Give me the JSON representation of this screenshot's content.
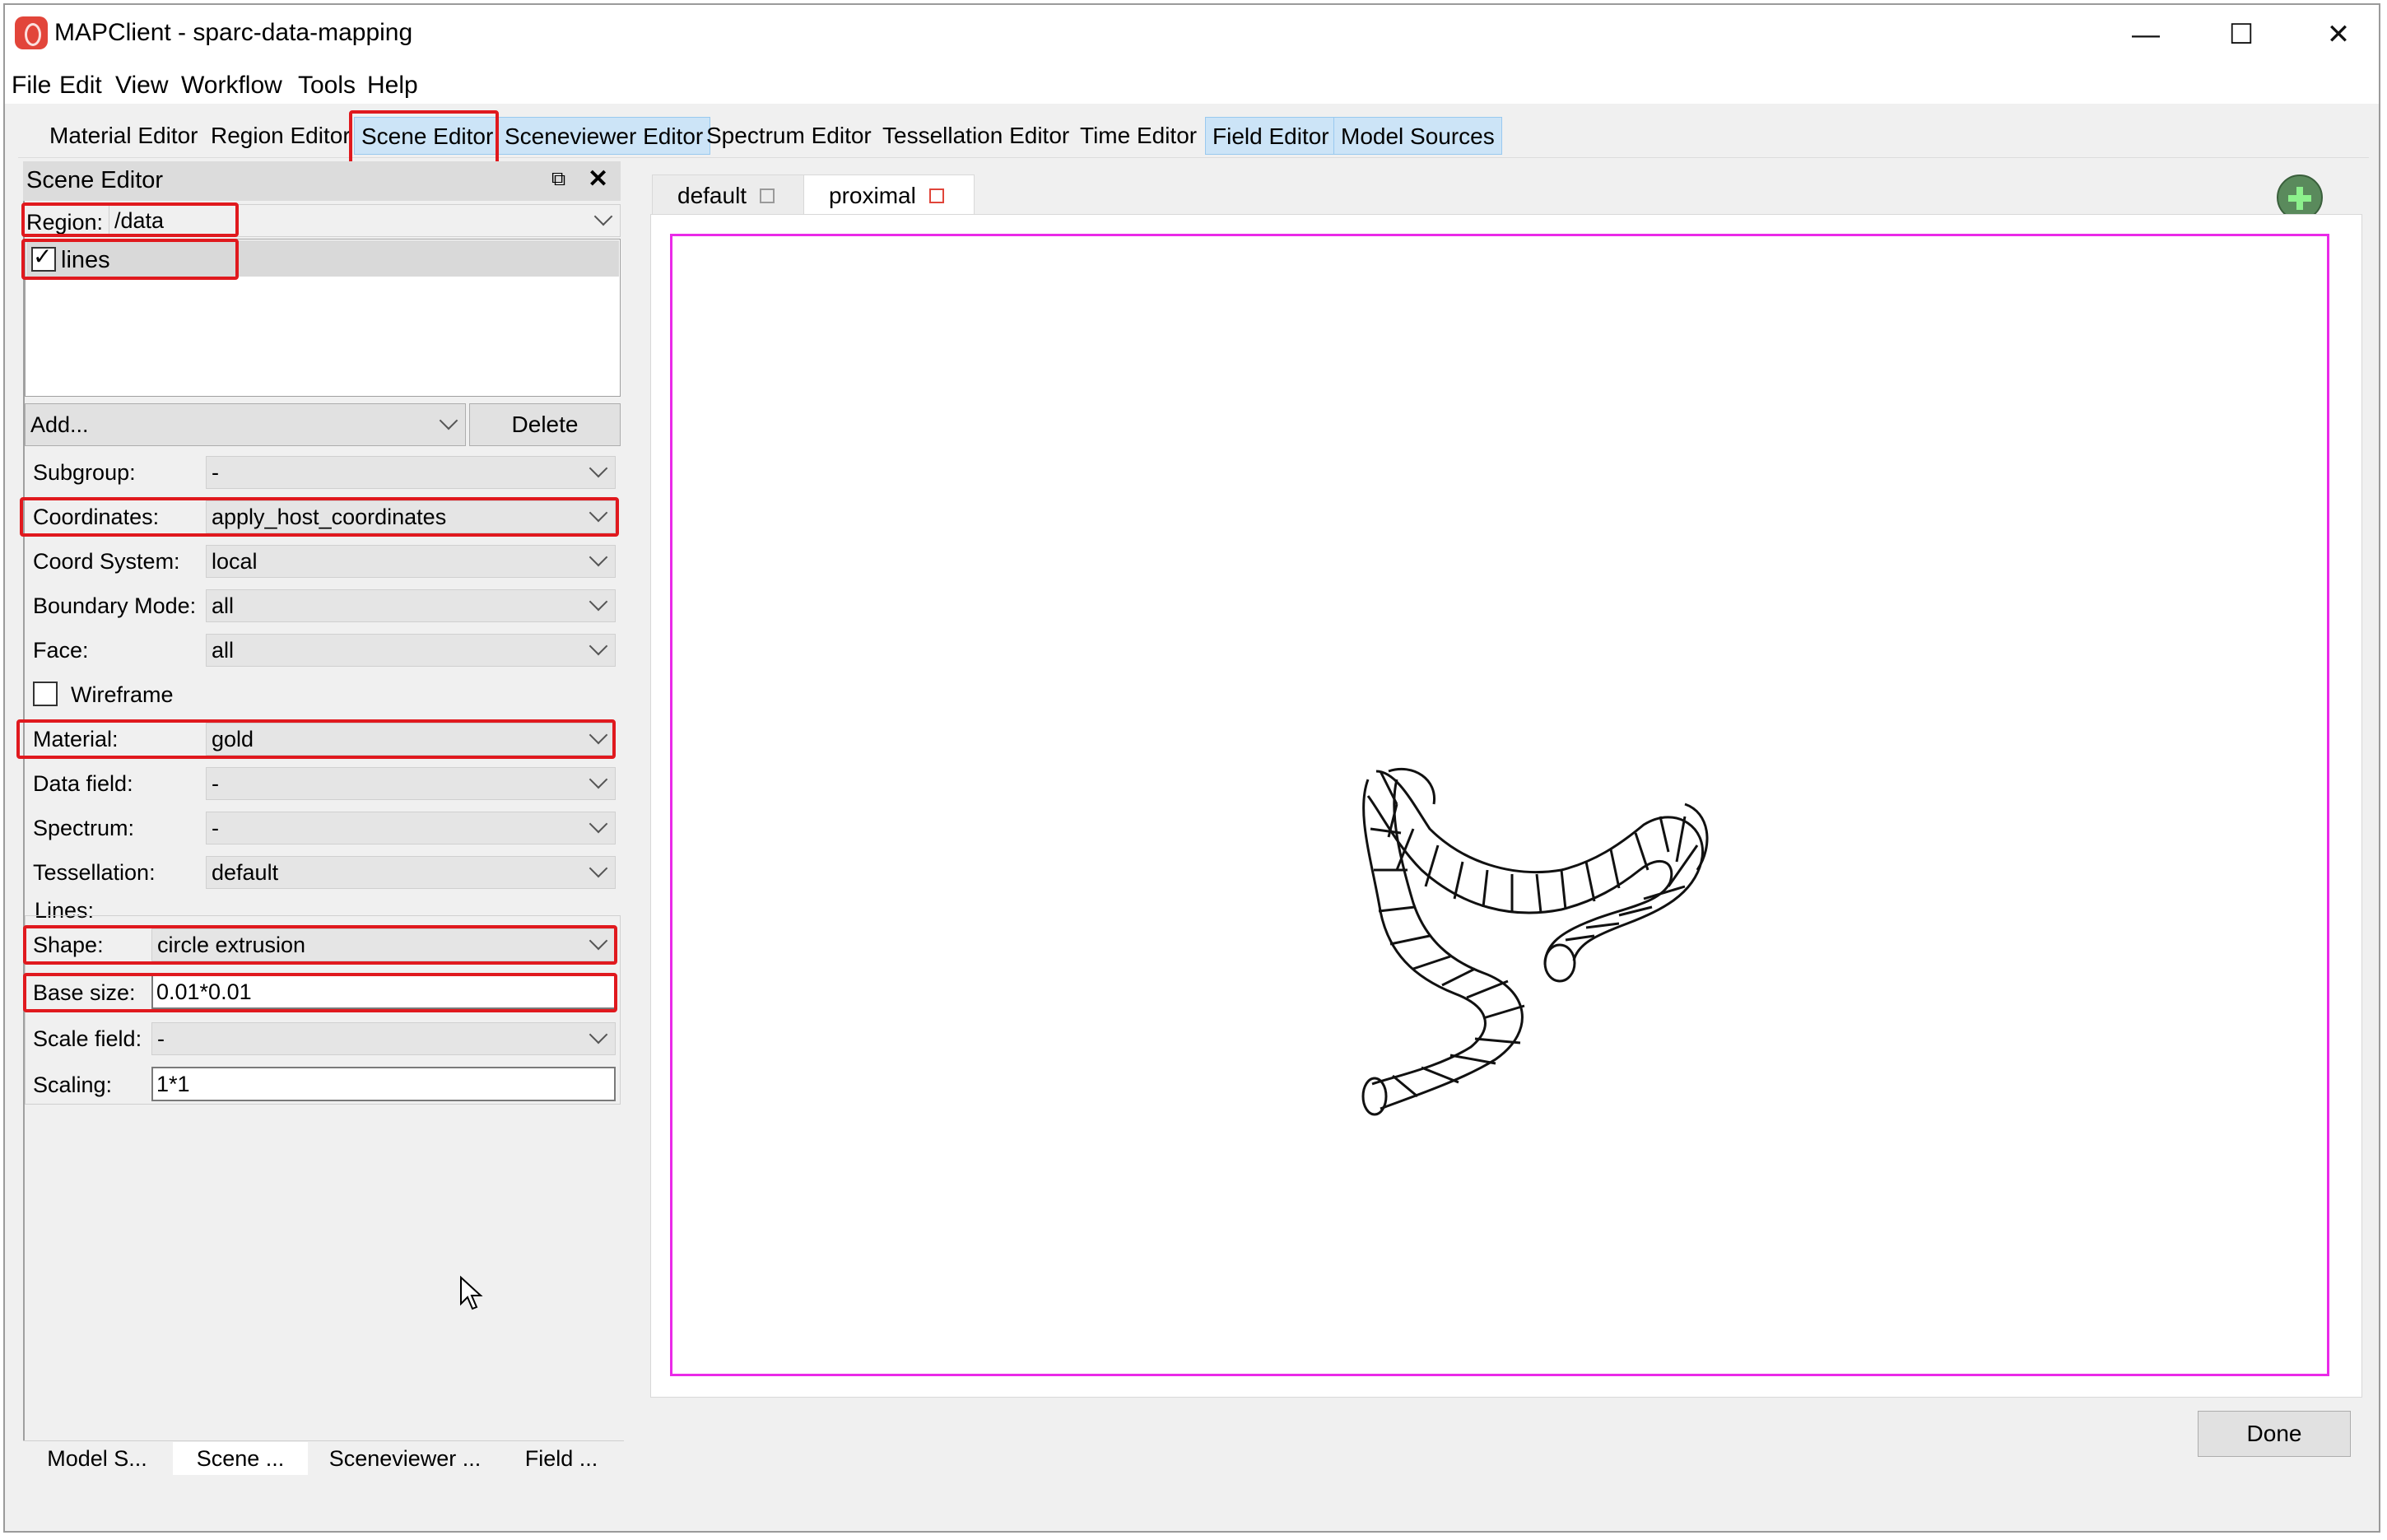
{
  "window": {
    "title": "MAPClient - sparc-data-mapping",
    "controls": {
      "minimize": "—",
      "maximize": "☐",
      "close": "✕"
    }
  },
  "menubar": [
    "File",
    "Edit",
    "View",
    "Workflow",
    "Tools",
    "Help"
  ],
  "toolbar": {
    "items": [
      {
        "label": "Material Editor",
        "active": false
      },
      {
        "label": "Region Editor",
        "active": false
      },
      {
        "label": "Scene Editor",
        "active": true
      },
      {
        "label": "Sceneviewer Editor",
        "active": true
      },
      {
        "label": "Spectrum Editor",
        "active": false
      },
      {
        "label": "Tessellation Editor",
        "active": false
      },
      {
        "label": "Time Editor",
        "active": false
      },
      {
        "label": "Field Editor",
        "active": true
      },
      {
        "label": "Model Sources",
        "active": true
      }
    ]
  },
  "scene_editor": {
    "title": "Scene Editor",
    "region_label": "Region:",
    "region_value": "/data",
    "graphics_list": [
      {
        "label": "lines",
        "checked": true
      }
    ],
    "add_label": "Add...",
    "delete_label": "Delete",
    "fields": {
      "subgroup": {
        "label": "Subgroup:",
        "value": "-"
      },
      "coordinates": {
        "label": "Coordinates:",
        "value": "apply_host_coordinates"
      },
      "coord_system": {
        "label": "Coord System:",
        "value": "local"
      },
      "boundary_mode": {
        "label": "Boundary Mode:",
        "value": "all"
      },
      "face": {
        "label": "Face:",
        "value": "all"
      },
      "wireframe": {
        "label": "Wireframe",
        "checked": false
      },
      "material": {
        "label": "Material:",
        "value": "gold"
      },
      "data_field": {
        "label": "Data field:",
        "value": "-"
      },
      "spectrum": {
        "label": "Spectrum:",
        "value": "-"
      },
      "tessellation": {
        "label": "Tessellation:",
        "value": "default"
      }
    },
    "lines_section": {
      "header": "Lines:",
      "shape": {
        "label": "Shape:",
        "value": "circle extrusion"
      },
      "base_size": {
        "label": "Base size:",
        "value": "0.01*0.01"
      },
      "scale_field": {
        "label": "Scale field:",
        "value": "-"
      },
      "scaling": {
        "label": "Scaling:",
        "value": "1*1"
      }
    }
  },
  "bottom_tabs": [
    "Model S...",
    "Scene ...",
    "Sceneviewer ...",
    "Field ..."
  ],
  "view_tabs": [
    {
      "label": "default",
      "active": false
    },
    {
      "label": "proximal",
      "active": true
    }
  ],
  "done_label": "Done",
  "colors": {
    "highlight_box": "#e0191e",
    "viewport_border": "#ea2ae8",
    "active_tab_bg": "#cce4f7",
    "add_button": "#5a8a5c"
  }
}
